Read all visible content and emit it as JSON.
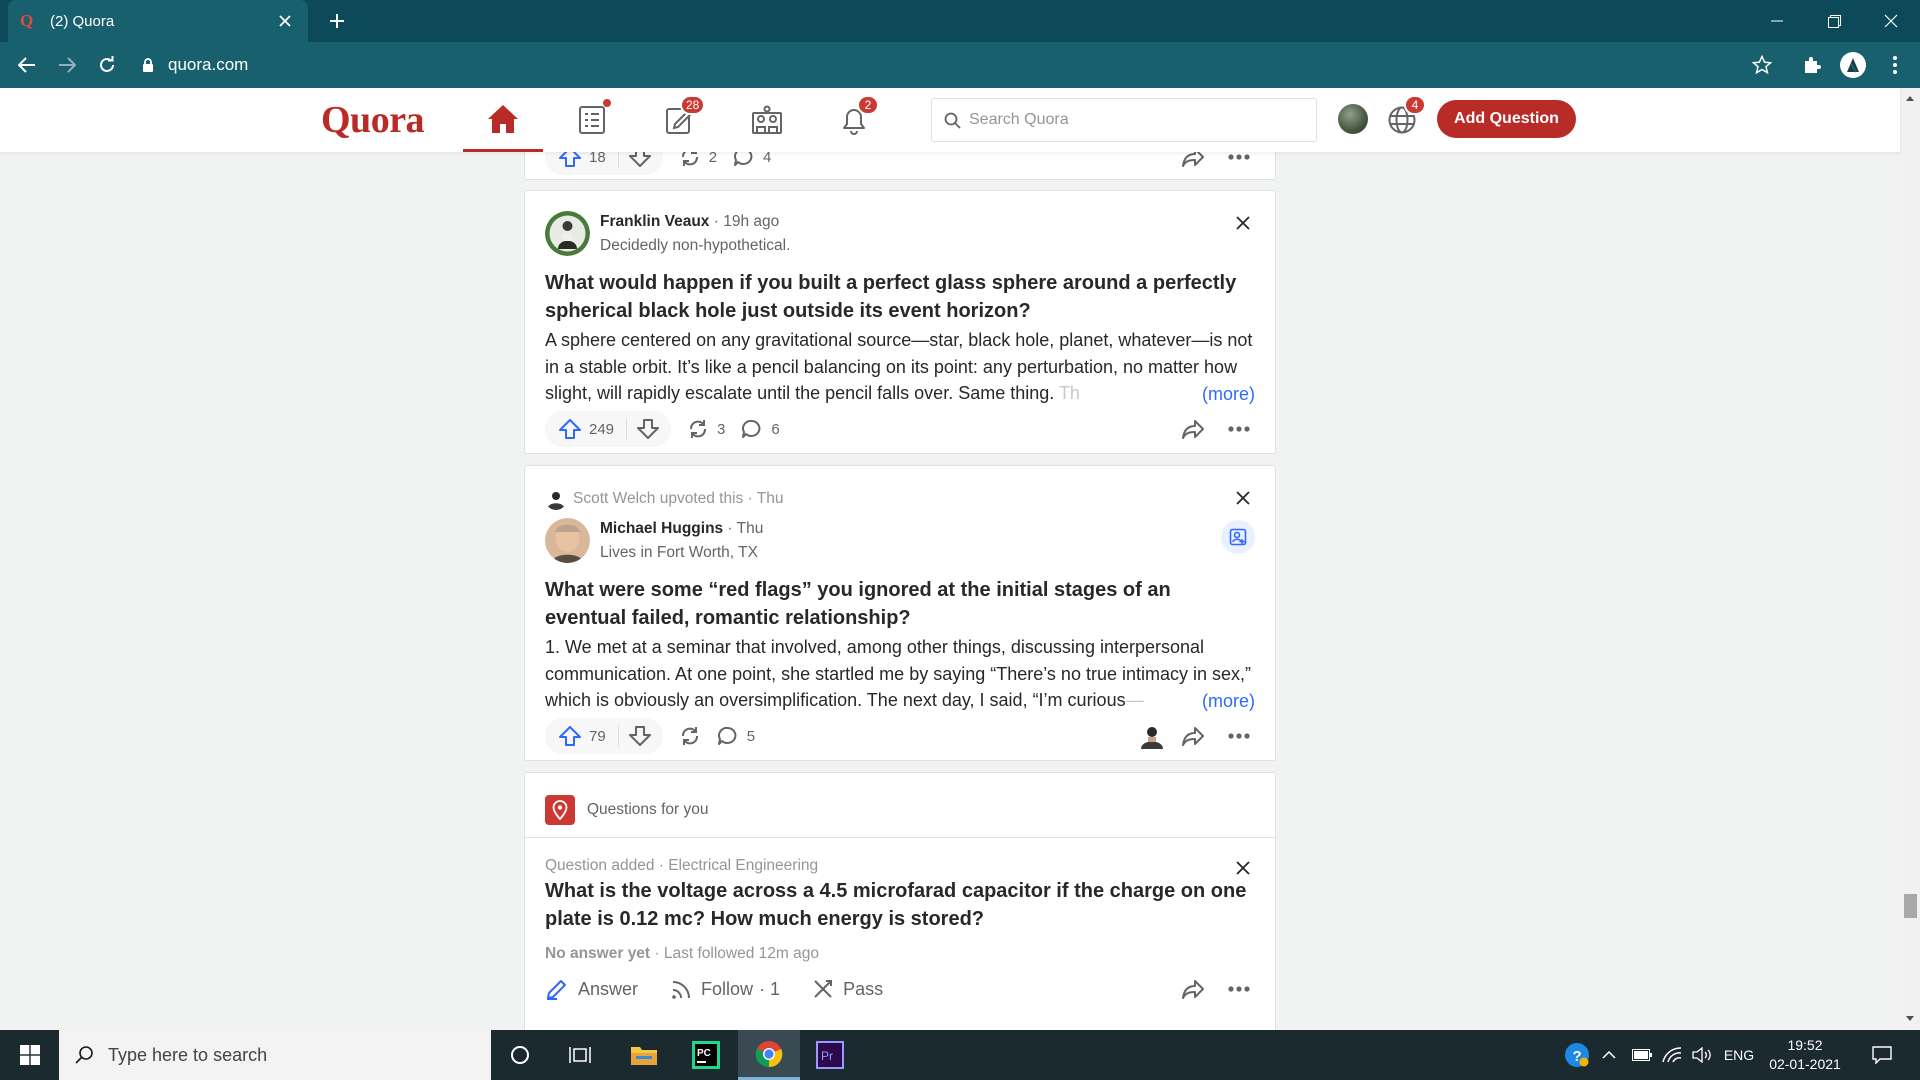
{
  "browser": {
    "tab_title": "(2) Quora",
    "url": "quora.com"
  },
  "header": {
    "logo": "Quora",
    "badges": {
      "answer": "28",
      "notifications": "2",
      "languages": "4"
    },
    "search_placeholder": "Search Quora",
    "add_question": "Add Question",
    "brand_color": "#b92b27"
  },
  "feed": {
    "top_card": {
      "upvotes": "18",
      "shares": "2",
      "comments": "4"
    },
    "post1": {
      "author": "Franklin Veaux",
      "time": "19h ago",
      "credential": "Decidedly non-hypothetical.",
      "question": "What would happen if you built a perfect glass sphere around a perfectly spherical black hole just outside its event horizon?",
      "body": "A sphere centered on any gravitational source—star, black hole, planet, whatever—is not in a stable orbit. It’s like a pencil balancing on its point: any perturbation, no matter how slight, will rapidly escalate until the pencil falls over. Same thing. ",
      "body_fade": "Th",
      "more": "(more)",
      "upvotes": "249",
      "shares": "3",
      "comments": "6"
    },
    "post2": {
      "upvoter": "Scott Welch upvoted this · Thu",
      "author": "Michael Huggins",
      "time": "Thu",
      "credential": "Lives in Fort Worth, TX",
      "question": "What were some “red flags” you ignored at the initial stages of an eventual failed, romantic relationship?",
      "body": "1. We met at a seminar that involved, among other things, discussing interpersonal communication. At one point, she startled me by saying “There’s no true intimacy in sex,” which is obviously an oversimplification. The next day, I said, “I’m curious",
      "body_fade": "—",
      "more": "(more)",
      "upvotes": "79",
      "comments": "5"
    },
    "questions_for_you": {
      "heading": "Questions for you",
      "meta": "Question added · Electrical Engineering",
      "question": "What is the voltage across a 4.5 microfarad capacitor if the charge on one plate is 0.12 mc? How much energy is stored?",
      "no_answer": "No answer yet",
      "followed": " · Last followed 12m ago",
      "answer_label": "Answer",
      "follow_label": "Follow",
      "follow_count": "· 1",
      "pass_label": "Pass"
    }
  },
  "taskbar": {
    "search_placeholder": "Type here to search",
    "language": "ENG",
    "time": "19:52",
    "date": "02-01-2021"
  }
}
